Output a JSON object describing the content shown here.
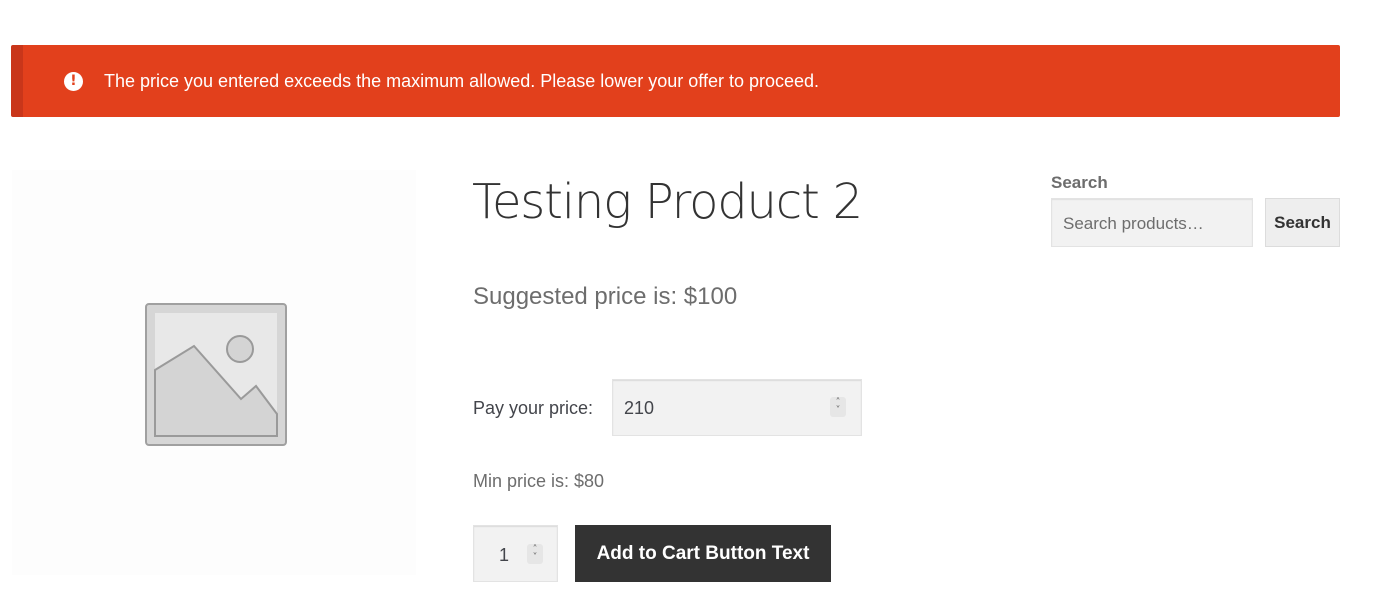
{
  "notice": {
    "icon": "exclamation-circle-icon",
    "message": "The price you entered exceeds the maximum allowed. Please lower your offer to proceed.",
    "background": "#e2401c"
  },
  "product": {
    "title": "Testing Product 2",
    "image_icon": "image-placeholder-icon",
    "suggested_price": "Suggested price is: $100",
    "pay_label": "Pay your price:",
    "pay_value": "210",
    "min_price": "Min price is: $80",
    "quantity": "1",
    "add_to_cart_label": "Add to Cart Button Text"
  },
  "sidebar": {
    "search_heading": "Search",
    "search_placeholder": "Search products…",
    "search_button": "Search"
  }
}
